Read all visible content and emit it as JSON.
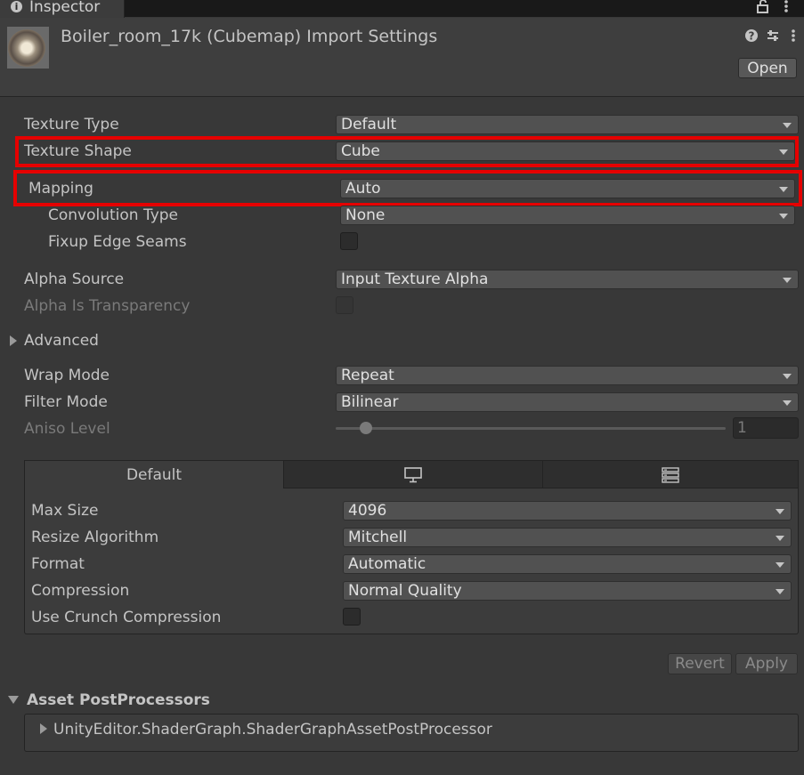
{
  "tab": {
    "title": "Inspector",
    "info_icon": "info-icon",
    "lock_icon": "lock-icon",
    "menu_icon": "kebab-menu-icon"
  },
  "header": {
    "title": "Boiler_room_17k (Cubemap) Import Settings",
    "open_label": "Open",
    "help_icon": "help-icon",
    "presets_icon": "presets-icon",
    "menu_icon": "kebab-menu-icon"
  },
  "fields": {
    "texture_type": {
      "label": "Texture Type",
      "value": "Default"
    },
    "texture_shape": {
      "label": "Texture Shape",
      "value": "Cube"
    },
    "mapping": {
      "label": "Mapping",
      "value": "Auto"
    },
    "convolution_type": {
      "label": "Convolution Type",
      "value": "None"
    },
    "fixup_edge_seams": {
      "label": "Fixup Edge Seams",
      "checked": false
    },
    "alpha_source": {
      "label": "Alpha Source",
      "value": "Input Texture Alpha"
    },
    "alpha_is_transparency": {
      "label": "Alpha Is Transparency",
      "checked": false
    },
    "advanced": {
      "label": "Advanced",
      "expanded": false
    },
    "wrap_mode": {
      "label": "Wrap Mode",
      "value": "Repeat"
    },
    "filter_mode": {
      "label": "Filter Mode",
      "value": "Bilinear"
    },
    "aniso_level": {
      "label": "Aniso Level",
      "value": "1"
    }
  },
  "platform": {
    "tabs": [
      {
        "label": "Default",
        "icon": ""
      },
      {
        "label": "",
        "icon": "monitor-icon"
      },
      {
        "label": "",
        "icon": "server-icon"
      }
    ],
    "max_size": {
      "label": "Max Size",
      "value": "4096"
    },
    "resize_algorithm": {
      "label": "Resize Algorithm",
      "value": "Mitchell"
    },
    "format": {
      "label": "Format",
      "value": "Automatic"
    },
    "compression": {
      "label": "Compression",
      "value": "Normal Quality"
    },
    "use_crunch": {
      "label": "Use Crunch Compression",
      "checked": false
    }
  },
  "buttons": {
    "revert": "Revert",
    "apply": "Apply"
  },
  "postprocessors": {
    "title": "Asset PostProcessors",
    "items": [
      "UnityEditor.ShaderGraph.ShaderGraphAssetPostProcessor"
    ]
  },
  "colors": {
    "highlight": "#e60000",
    "background": "#383838"
  }
}
